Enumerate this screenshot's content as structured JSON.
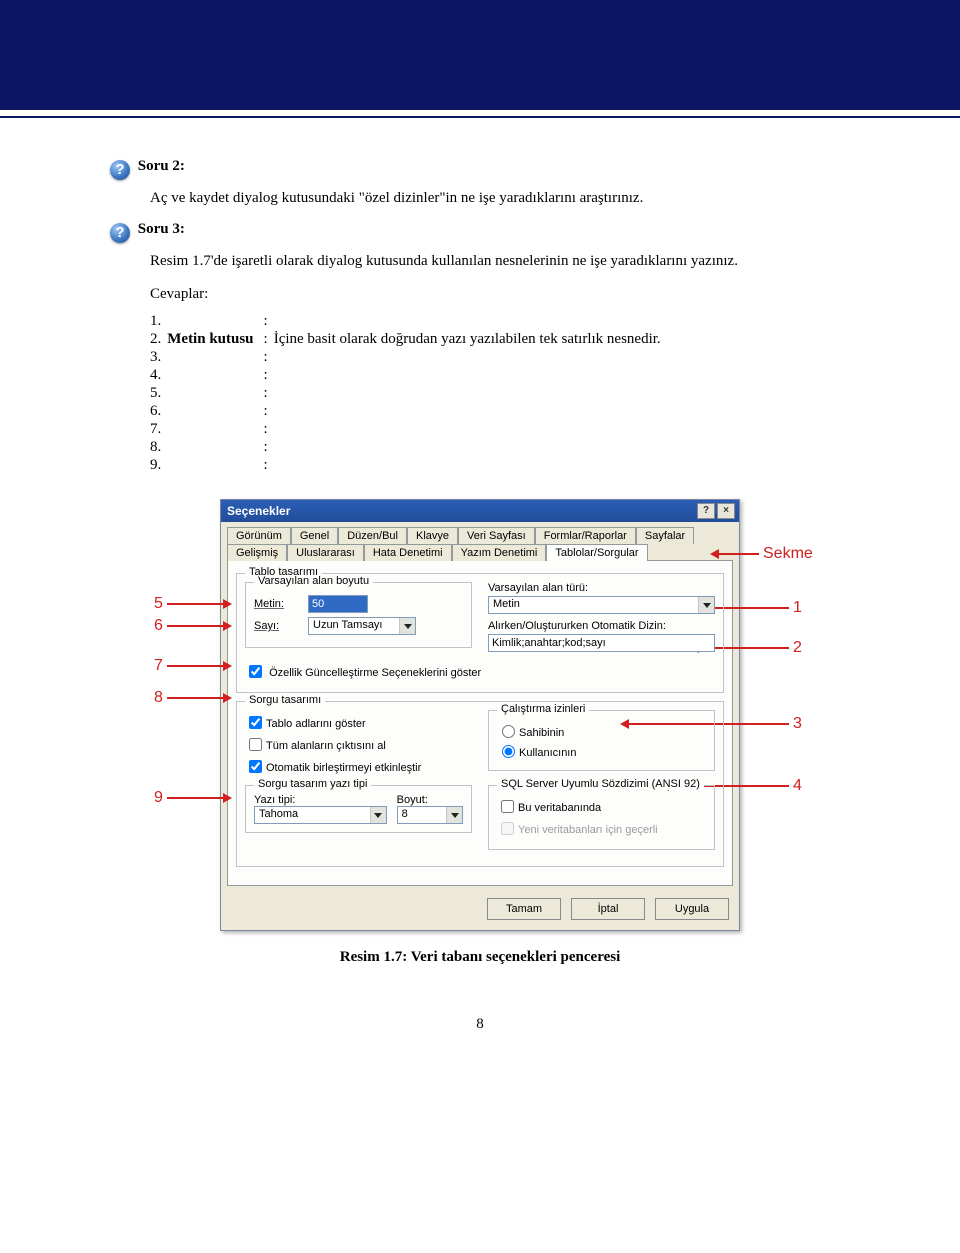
{
  "header": {},
  "q2": {
    "icon": "?",
    "label": "Soru 2:",
    "text": "Aç ve kaydet diyalog kutusundaki \"özel dizinler\"in ne işe yaradıklarını araştırınız."
  },
  "q3": {
    "icon": "?",
    "label": "Soru 3:",
    "text": "Resim 1.7'de işaretli olarak diyalog kutusunda kullanılan nesnelerinin ne işe yaradıklarını yazınız."
  },
  "cevaplar_label": "Cevaplar:",
  "answers": [
    {
      "num": "1.",
      "term": "",
      "desc": ""
    },
    {
      "num": "2.",
      "term": "Metin kutusu",
      "desc": "İçine basit olarak doğrudan yazı yazılabilen tek satırlık nesnedir."
    },
    {
      "num": "3.",
      "term": "",
      "desc": ""
    },
    {
      "num": "4.",
      "term": "",
      "desc": ""
    },
    {
      "num": "5.",
      "term": "",
      "desc": ""
    },
    {
      "num": "6.",
      "term": "",
      "desc": ""
    },
    {
      "num": "7.",
      "term": "",
      "desc": ""
    },
    {
      "num": "8.",
      "term": "",
      "desc": ""
    },
    {
      "num": "9.",
      "term": "",
      "desc": ""
    }
  ],
  "callouts": {
    "left": {
      "c5": "5",
      "c6": "6",
      "c7": "7",
      "c8": "8",
      "c9": "9"
    },
    "right": {
      "sekme": "Sekme",
      "c1": "1",
      "c2": "2",
      "c3": "3",
      "c4": "4"
    }
  },
  "dialog": {
    "title": "Seçenekler",
    "help_btn": "?",
    "close_btn": "×",
    "tabs_top": [
      "Görünüm",
      "Genel",
      "Düzen/Bul",
      "Klavye",
      "Veri Sayfası",
      "Formlar/Raporlar",
      "Sayfalar"
    ],
    "tabs_bot": [
      "Gelişmiş",
      "Uluslararası",
      "Hata Denetimi",
      "Yazım Denetimi",
      "Tablolar/Sorgular"
    ],
    "active_tab": "Tablolar/Sorgular",
    "gb_tablo": "Tablo tasarımı",
    "gb_varsayilan": "Varsayılan alan boyutu",
    "lbl_metin": "Metin:",
    "val_metin": "50",
    "lbl_sayi": "Sayı:",
    "val_sayi": "Uzun Tamsayı",
    "lbl_varsayilan_tur": "Varsayılan alan türü:",
    "val_varsayilan_tur": "Metin",
    "lbl_alirken": "Alırken/Oluştururken Otomatik Dizin:",
    "val_alirken": "Kimlik;anahtar;kod;sayı",
    "chk_ozellik": "Özellik Güncelleştirme Seçeneklerini göster",
    "gb_sorgu": "Sorgu tasarımı",
    "chk_tablo_adlari": "Tablo adlarını göster",
    "chk_tum_alanlar": "Tüm alanların çıktısını al",
    "chk_otomatik": "Otomatik birleştirmeyi etkinleştir",
    "gb_calistirma": "Çalıştırma izinleri",
    "rad_sahibinin": "Sahibinin",
    "rad_kullanicinin": "Kullanıcının",
    "gb_yazitipi": "Sorgu tasarım yazı tipi",
    "lbl_yazitipi": "Yazı tipi:",
    "val_yazitipi": "Tahoma",
    "lbl_boyut": "Boyut:",
    "val_boyut": "8",
    "gb_sql": "SQL Server Uyumlu Sözdizimi (ANSI 92)",
    "chk_bu_veritabani": "Bu veritabanında",
    "chk_yeni_veritabani": "Yeni veritabanları için geçerli",
    "btn_tamam": "Tamam",
    "btn_iptal": "İptal",
    "btn_uygula": "Uygula"
  },
  "caption": "Resim 1.7: Veri tabanı seçenekleri penceresi",
  "page_number": "8"
}
